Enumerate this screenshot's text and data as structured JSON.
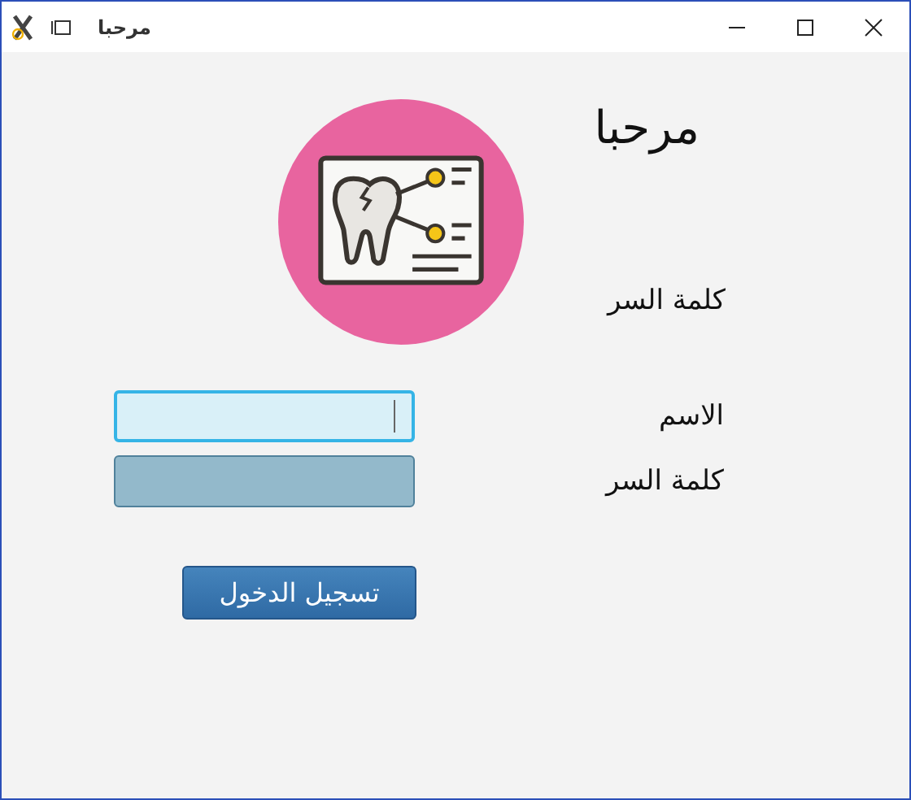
{
  "window": {
    "title": "مرحبا"
  },
  "header": {
    "greeting": "مرحبا",
    "caption": "كلمة السر"
  },
  "fields": [
    {
      "label": "الاسم",
      "focused": true
    },
    {
      "label": "كلمة السر",
      "focused": false
    }
  ],
  "login_button": {
    "label": "تسجيل الدخول"
  }
}
